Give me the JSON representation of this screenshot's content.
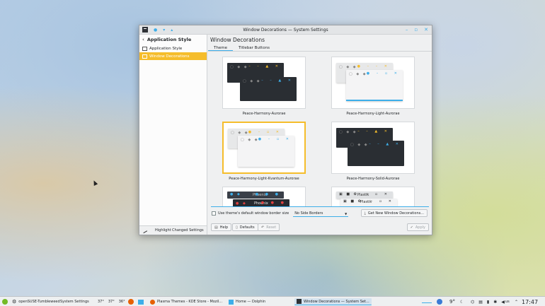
{
  "window": {
    "title": "Window Decorations — System Settings",
    "titlebar_buttons": [
      "●",
      "▾",
      "▴"
    ],
    "controls": [
      "–",
      "▫",
      "✕"
    ]
  },
  "sidebar": {
    "header": "Application Style",
    "items": [
      {
        "label": "Application Style"
      },
      {
        "label": "Window Decorations"
      }
    ],
    "footer": "Highlight Changed Settings"
  },
  "main": {
    "title": "Window Decorations",
    "tabs": [
      "Theme",
      "Titlebar Buttons"
    ],
    "themes": [
      {
        "name": "Peace-Harmony-Aurorae",
        "style": "dark"
      },
      {
        "name": "Peace-Harmony-Light-Aurorae",
        "style": "light"
      },
      {
        "name": "Peace-Harmony-Light-Kvantum-Aurorae",
        "style": "light",
        "selected": true
      },
      {
        "name": "Peace-Harmony-Solid-Aurorae",
        "style": "dark"
      },
      {
        "name": "Phoenix",
        "style": "phoenix"
      },
      {
        "name": "Plastik",
        "style": "plastik"
      }
    ],
    "options": {
      "use_default_border_label": "Use theme's default window border size",
      "border_select": "No Side Borders",
      "get_new": "Get New Window Decorations..."
    },
    "buttons": {
      "help": "Help",
      "defaults": "Defaults",
      "reset": "Reset",
      "apply": "Apply"
    }
  },
  "taskbar": {
    "activity": "openSUSE-Tumbleweed",
    "settings_label": "System Settings",
    "temps": [
      "37°",
      "37°",
      "36°"
    ],
    "tasks": [
      {
        "label": "Plasma Themes - KDE Store - Mozil..."
      },
      {
        "label": "Home — Dolphin"
      },
      {
        "label": "Window Decorations — System Set..."
      }
    ],
    "weather": "9°",
    "keyboard": "us",
    "time": "17:47"
  }
}
